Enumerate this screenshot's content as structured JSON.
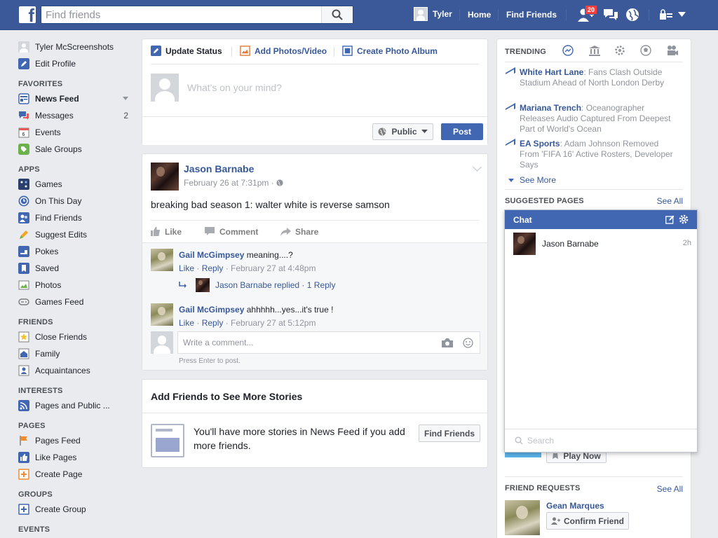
{
  "topbar": {
    "logo_letter": "f",
    "search_placeholder": "Find friends",
    "user_name": "Tyler",
    "home": "Home",
    "find_friends": "Find Friends",
    "friend_request_badge": "20"
  },
  "leftnav": {
    "profile_name": "Tyler McScreenshots",
    "edit_profile": "Edit Profile",
    "favorites_heading": "FAVORITES",
    "favorites": [
      {
        "label": "News Feed",
        "count": ""
      },
      {
        "label": "Messages",
        "count": "2"
      },
      {
        "label": "Events",
        "count": ""
      },
      {
        "label": "Sale Groups",
        "count": ""
      }
    ],
    "apps_heading": "APPS",
    "apps": [
      "Games",
      "On This Day",
      "Find Friends",
      "Suggest Edits",
      "Pokes",
      "Saved",
      "Photos",
      "Games Feed"
    ],
    "friends_heading": "FRIENDS",
    "friends": [
      "Close Friends",
      "Family",
      "Acquaintances"
    ],
    "interests_heading": "INTERESTS",
    "interests": [
      "Pages and Public ..."
    ],
    "pages_heading": "PAGES",
    "pages": [
      "Pages Feed",
      "Like Pages",
      "Create Page"
    ],
    "groups_heading": "GROUPS",
    "groups": [
      "Create Group"
    ],
    "events_heading": "EVENTS"
  },
  "composer": {
    "tab_update": "Update Status",
    "tab_photos": "Add Photos/Video",
    "tab_album": "Create Photo Album",
    "placeholder": "What's on your mind?",
    "privacy": "Public",
    "post": "Post"
  },
  "post": {
    "author": "Jason Barnabe",
    "time": "February 26 at 7:31pm",
    "text": "breaking bad season 1: walter white is reverse samson",
    "like": "Like",
    "comment": "Comment",
    "share": "Share",
    "comments": [
      {
        "author": "Gail McGimpsey",
        "text": "meaning....?",
        "like": "Like",
        "reply": "Reply",
        "time": "February 27 at 4:48pm"
      },
      {
        "author": "Gail McGimpsey",
        "text": "ahhhhh...yes...it's true !",
        "like": "Like",
        "reply": "Reply",
        "time": "February 27 at 5:12pm"
      }
    ],
    "reply_summary_name": "Jason Barnabe replied",
    "reply_summary_count": "1 Reply",
    "write_placeholder": "Write a comment...",
    "press_enter": "Press Enter to post."
  },
  "addfriends": {
    "title": "Add Friends to See More Stories",
    "text": "You'll have more stories in News Feed if you add more friends.",
    "button": "Find Friends"
  },
  "trending": {
    "heading": "TRENDING",
    "items": [
      {
        "topic": "White Hart Lane",
        "desc": ": Fans Clash Outside Stadium Ahead of North London Derby"
      },
      {
        "topic": "Mariana Trench",
        "desc": ": Oceanographer Releases Audio Captured From Deepest Part of World's Ocean"
      },
      {
        "topic": "EA Sports",
        "desc": ": Adam Johnson Removed From 'FIFA 16' Active Rosters, Developer Says"
      }
    ],
    "see_more": "See More"
  },
  "suggested": {
    "heading": "SUGGESTED PAGES",
    "see_all": "See All",
    "play_now": "Play Now"
  },
  "friend_requests": {
    "heading": "FRIEND REQUESTS",
    "see_all": "See All",
    "name": "Gean Marques",
    "confirm": "Confirm Friend"
  },
  "chat": {
    "title": "Chat",
    "contact": "Jason Barnabe",
    "contact_time": "2h",
    "search_placeholder": "Search"
  },
  "colors": {
    "brand_blue": "#3b5998",
    "link_blue": "#365899",
    "button_blue": "#4267b2",
    "badge_red": "#fa3e3e",
    "page_bg": "#e9ebee"
  }
}
